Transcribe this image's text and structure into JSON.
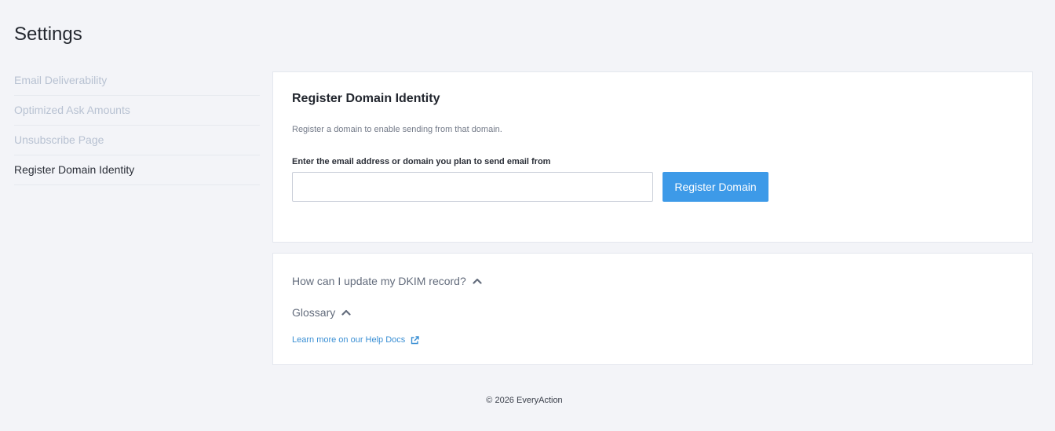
{
  "page": {
    "title": "Settings"
  },
  "sidebar": {
    "items": [
      {
        "label": "Email Deliverability",
        "active": false
      },
      {
        "label": "Optimized Ask Amounts",
        "active": false
      },
      {
        "label": "Unsubscribe Page",
        "active": false
      },
      {
        "label": "Register Domain Identity",
        "active": true
      }
    ]
  },
  "register_card": {
    "title": "Register Domain Identity",
    "description": "Register a domain to enable sending from that domain.",
    "field_label": "Enter the email address or domain you plan to send email from",
    "input_value": "",
    "input_placeholder": "",
    "button_label": "Register Domain"
  },
  "help_card": {
    "dkim_label": "How can I update my DKIM record?",
    "glossary_label": "Glossary",
    "help_link_label": "Learn more on our Help Docs"
  },
  "footer": {
    "copyright": "© 2026 EveryAction"
  },
  "icons": {
    "chevron": "chevron-up-icon",
    "external_link": "external-link-icon"
  },
  "colors": {
    "accent": "#3d9ae8",
    "link": "#3a8fd4",
    "background": "#f3f4f8",
    "sidebar_inactive": "#b8c2d2"
  }
}
